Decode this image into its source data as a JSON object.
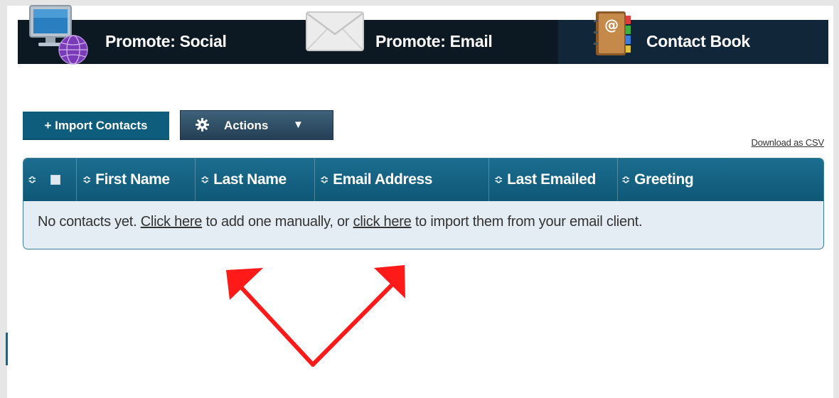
{
  "nav": {
    "tabs": [
      {
        "label": "Promote: Social",
        "icon": "globe-monitor-icon"
      },
      {
        "label": "Promote: Email",
        "icon": "envelope-icon"
      },
      {
        "label": "Contact Book",
        "icon": "address-book-icon",
        "active": true
      }
    ]
  },
  "toolbar": {
    "import_label": "+ Import Contacts",
    "actions_label": "Actions",
    "actions_caret": "▼",
    "download_label": "Download as CSV"
  },
  "table": {
    "sort_glyph": "≎",
    "columns": [
      "First Name",
      "Last Name",
      "Email Address",
      "Last Emailed",
      "Greeting"
    ],
    "empty": {
      "prefix": "No contacts yet.",
      "link1": "Click here",
      "middle": "to add one manually, or",
      "link2": "click here",
      "suffix": "to import them from your email client."
    }
  },
  "colors": {
    "nav_bg": "#0c1822",
    "header_blue": "#0f5d7d",
    "row_bg": "#e3edf3",
    "annotation_red": "#ff1a1a"
  }
}
